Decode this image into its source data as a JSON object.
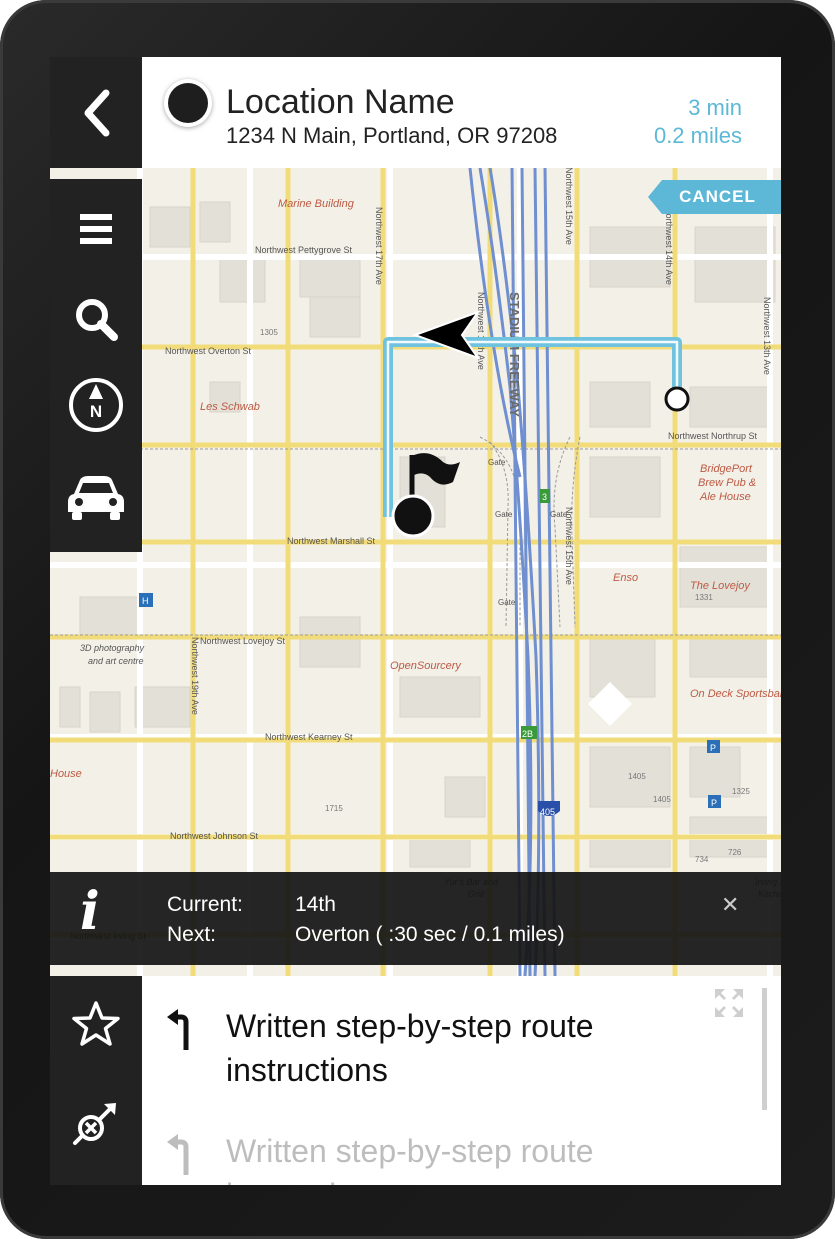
{
  "header": {
    "location_name": "Location Name",
    "address": "1234 N Main, Portland, OR 97208",
    "eta": "3 min",
    "distance": "0.2 miles"
  },
  "cancel_label": "CANCEL",
  "info": {
    "current_label": "Current:",
    "current_value": "14th",
    "next_label": "Next:",
    "next_value": "Overton ( :30 sec / 0.1 miles)"
  },
  "steps": [
    {
      "text": "Written step-by-step route instructions"
    },
    {
      "text": "Written step-by-step route instructions"
    }
  ],
  "map": {
    "streets": [
      "Northwest Pettygrove St",
      "Northwest Overton St",
      "Northwest Northrup St",
      "Northwest Marshall St",
      "Northwest Lovejoy St",
      "Northwest Kearney St",
      "Northwest Johnson St",
      "Northwest Irving St",
      "Northwest 17th Ave",
      "Northwest 16th Ave",
      "Northwest 15th Ave",
      "Northwest 14th Ave",
      "Northwest 13th Ave",
      "Northwest 19th Ave",
      "Stadium Freeway"
    ],
    "places": [
      "Marine Building",
      "Les Schwab",
      "BridgePort Brew Pub & Ale House",
      "Enso",
      "The Lovejoy",
      "OpenSourcery",
      "3D photography and art centre",
      "On Deck Sportsbar",
      "Yur's Bar and Grill",
      "Irving Street Kitchen",
      "House"
    ],
    "numbers": [
      "1305",
      "1331",
      "1405",
      "1405",
      "1325",
      "1715",
      "734",
      "726"
    ],
    "highways": [
      "3",
      "2B",
      "405"
    ],
    "gates": [
      "Gate",
      "Gate",
      "Gate",
      "Gate"
    ]
  },
  "colors": {
    "accent": "#5cb8d6",
    "route": "#6fc3de",
    "sidebar": "#222222",
    "road_major": "#f2dc7a",
    "freeway": "#6f8fd0"
  },
  "icons": {
    "back": "chevron-left-icon",
    "menu": "hamburger-menu-icon",
    "search": "search-icon",
    "compass": "compass-north-icon",
    "car": "car-icon",
    "favorite": "star-icon",
    "route_options": "no-route-icon",
    "info": "info-icon",
    "close": "close-icon",
    "expand": "expand-icon",
    "turn": "turn-left-icon"
  }
}
